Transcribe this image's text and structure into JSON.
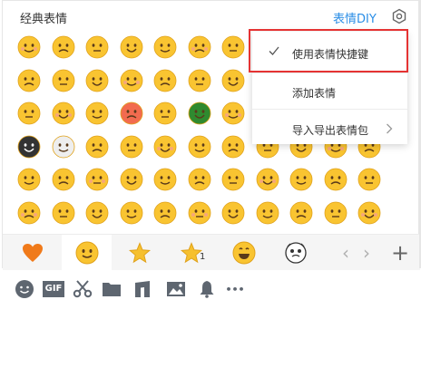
{
  "header": {
    "title": "经典表情",
    "diy_label": "表情DIY",
    "settings_icon": "gear-icon"
  },
  "menu": {
    "items": [
      {
        "label": "使用表情快捷键",
        "checked": true
      },
      {
        "label": "添加表情",
        "checked": false
      },
      {
        "label": "导入导出表情包",
        "checked": false,
        "has_submenu": true
      }
    ]
  },
  "tabs": {
    "items": [
      {
        "name": "favorites",
        "icon": "heart-icon"
      },
      {
        "name": "classic",
        "icon": "smiley-icon"
      },
      {
        "name": "star",
        "icon": "star-icon"
      },
      {
        "name": "star-1",
        "icon": "star-icon",
        "badge": "1"
      },
      {
        "name": "grin",
        "icon": "grin-face-icon"
      },
      {
        "name": "cartoon",
        "icon": "cartoon-face-icon"
      }
    ],
    "prev": "‹",
    "next": "›",
    "add": "+"
  },
  "toolbar": {
    "items": [
      "emoji-icon",
      "gif-icon",
      "scissors-icon",
      "folder-icon",
      "music-icon",
      "image-icon",
      "bell-icon",
      "more-icon"
    ],
    "gif_label": "GIF",
    "more_label": "•••"
  },
  "colors": {
    "accent": "#2b8ee6",
    "highlight_border": "#e53333",
    "emoji_yellow": "#f9c431",
    "heart": "#f07a1a"
  }
}
